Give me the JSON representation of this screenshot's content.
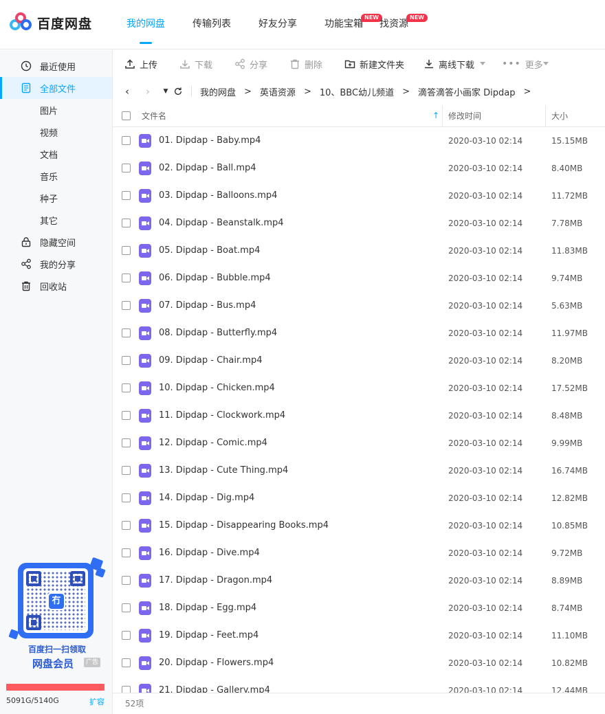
{
  "app": {
    "logo_text": "百度网盘"
  },
  "nav": [
    {
      "label": "我的网盘",
      "active": true
    },
    {
      "label": "传输列表"
    },
    {
      "label": "好友分享"
    },
    {
      "label": "功能宝箱",
      "badge": "NEW"
    },
    {
      "label": "找资源",
      "badge": "NEW"
    }
  ],
  "sidebar": {
    "items": [
      {
        "label": "最近使用",
        "icon": "clock-icon"
      },
      {
        "label": "全部文件",
        "icon": "document-icon",
        "active": true
      },
      {
        "label": "图片"
      },
      {
        "label": "视频"
      },
      {
        "label": "文档"
      },
      {
        "label": "音乐"
      },
      {
        "label": "种子"
      },
      {
        "label": "其它"
      },
      {
        "label": "隐藏空间",
        "icon": "lock-icon"
      },
      {
        "label": "我的分享",
        "icon": "share-icon"
      },
      {
        "label": "回收站",
        "icon": "trash-icon"
      }
    ],
    "promo": {
      "line1": "百度扫一扫领取",
      "line2": "网盘会员",
      "ad": "广告",
      "qr_center": "冇"
    },
    "quota": {
      "text": "5091G/5140G",
      "expand": "扩容",
      "used_fraction": 0.9905,
      "bar_color": "#ff5a5f"
    }
  },
  "toolbar": {
    "upload": "上传",
    "download": "下载",
    "share": "分享",
    "delete": "删除",
    "new_folder": "新建文件夹",
    "offline_download": "离线下载",
    "more": "更多"
  },
  "breadcrumb": [
    "我的网盘",
    "英语资源",
    "10、BBC幼儿频道",
    "滴答滴答小画家 Dipdap"
  ],
  "breadcrumb_sep": ">",
  "table": {
    "headers": {
      "name": "文件名",
      "modified": "修改时间",
      "size": "大小"
    },
    "rows": [
      {
        "name": "01. Dipdap - Baby.mp4",
        "date": "2020-03-10 02:14",
        "size": "15.15MB"
      },
      {
        "name": "02. Dipdap - Ball.mp4",
        "date": "2020-03-10 02:14",
        "size": "8.40MB"
      },
      {
        "name": "03. Dipdap - Balloons.mp4",
        "date": "2020-03-10 02:14",
        "size": "11.72MB"
      },
      {
        "name": "04. Dipdap - Beanstalk.mp4",
        "date": "2020-03-10 02:14",
        "size": "7.78MB"
      },
      {
        "name": "05. Dipdap - Boat.mp4",
        "date": "2020-03-10 02:14",
        "size": "11.83MB"
      },
      {
        "name": "06. Dipdap - Bubble.mp4",
        "date": "2020-03-10 02:14",
        "size": "9.74MB"
      },
      {
        "name": "07. Dipdap - Bus.mp4",
        "date": "2020-03-10 02:14",
        "size": "5.63MB"
      },
      {
        "name": "08. Dipdap - Butterfly.mp4",
        "date": "2020-03-10 02:14",
        "size": "11.97MB"
      },
      {
        "name": "09. Dipdap - Chair.mp4",
        "date": "2020-03-10 02:14",
        "size": "8.20MB"
      },
      {
        "name": "10. Dipdap - Chicken.mp4",
        "date": "2020-03-10 02:14",
        "size": "17.52MB"
      },
      {
        "name": "11. Dipdap - Clockwork.mp4",
        "date": "2020-03-10 02:14",
        "size": "8.48MB"
      },
      {
        "name": "12. Dipdap - Comic.mp4",
        "date": "2020-03-10 02:14",
        "size": "9.99MB"
      },
      {
        "name": "13. Dipdap - Cute Thing.mp4",
        "date": "2020-03-10 02:14",
        "size": "16.74MB"
      },
      {
        "name": "14. Dipdap - Dig.mp4",
        "date": "2020-03-10 02:14",
        "size": "12.82MB"
      },
      {
        "name": "15. Dipdap - Disappearing Books.mp4",
        "date": "2020-03-10 02:14",
        "size": "10.85MB"
      },
      {
        "name": "16. Dipdap - Dive.mp4",
        "date": "2020-03-10 02:14",
        "size": "9.72MB"
      },
      {
        "name": "17. Dipdap - Dragon.mp4",
        "date": "2020-03-10 02:14",
        "size": "8.89MB"
      },
      {
        "name": "18. Dipdap - Egg.mp4",
        "date": "2020-03-10 02:14",
        "size": "8.74MB"
      },
      {
        "name": "19. Dipdap - Feet.mp4",
        "date": "2020-03-10 02:14",
        "size": "11.10MB"
      },
      {
        "name": "20. Dipdap - Flowers.mp4",
        "date": "2020-03-10 02:14",
        "size": "10.82MB"
      },
      {
        "name": "21. Dipdap - Gallery.mp4",
        "date": "2020-03-10 02:14",
        "size": "12.44MB"
      }
    ]
  },
  "footer": {
    "count": "52项"
  },
  "colors": {
    "accent": "#06a7ff",
    "badge": "#f2334a",
    "video_icon": "#7b68ee",
    "quota_bar": "#ff5a5f"
  }
}
